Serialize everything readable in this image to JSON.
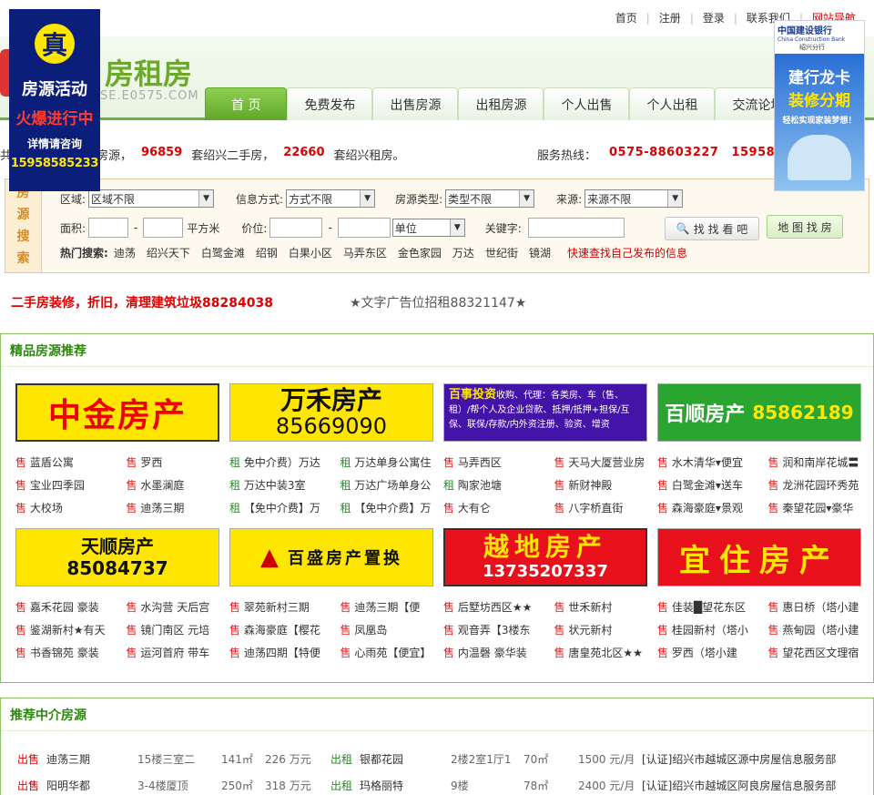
{
  "top_links": [
    "首页",
    "注册",
    "登录",
    "联系我们",
    "网站导航"
  ],
  "logo": {
    "title": "房租房",
    "sub": "SE.E0575.COM"
  },
  "nav": [
    "首 页",
    "免费发布",
    "出售房源",
    "出租房源",
    "个人出售",
    "个人出租",
    "交流论坛"
  ],
  "stats": {
    "prefix": "共",
    "mid1": "套房源，",
    "count1": "96859",
    "mid2": "套绍兴二手房，",
    "count2": "22660",
    "mid3": "套绍兴租房。",
    "hotline_label": "服务热线：",
    "hotline1": "0575-88603227",
    "hotline2": "159585"
  },
  "search": {
    "label": [
      "房",
      "源",
      "搜",
      "索"
    ],
    "area_label": "区域:",
    "area_value": "区域不限",
    "method_label": "信息方式:",
    "method_value": "方式不限",
    "type_label": "房源类型:",
    "type_value": "类型不限",
    "source_label": "来源:",
    "source_value": "来源不限",
    "size_label": "面积:",
    "size_unit": "平方米",
    "dash": "-",
    "price_label": "价位:",
    "price_unit": "单位",
    "keyword_label": "关键字:",
    "search_btn": "找 找 看 吧",
    "map_btn": "地 图 找 房",
    "hot_label": "热门搜索:",
    "hot_items": [
      "迪荡",
      "绍兴天下",
      "白鹭金滩",
      "绍钢",
      "白果小区",
      "马弄东区",
      "金色家园",
      "万达",
      "世纪街",
      "镜湖"
    ],
    "hot_red": "快速查找自己发布的信息"
  },
  "ads": {
    "left": "二手房装修，折旧，清理建筑垃圾88284038",
    "right": "★文字广告位招租88321147★"
  },
  "featured": {
    "title": "精品房源推荐",
    "banners1": [
      {
        "name": "中金房产",
        "phone": ""
      },
      {
        "name": "万禾房产",
        "phone": "85669090"
      },
      {
        "name": "百事投资",
        "phone": "收购、代理：各类房、车（售、租）/帮个人及企业贷款、抵押/抵押+担保/互保、联保/存款/内外资注册、验资、增资"
      },
      {
        "name": "百顺房产",
        "phone": "85862189"
      }
    ],
    "list1": [
      [
        [
          "售",
          "蓝盾公寓",
          "售",
          "罗西"
        ],
        [
          "售",
          "宝业四季园",
          "售",
          "水墨澜庭"
        ],
        [
          "售",
          "大校场",
          "售",
          "迪荡三期"
        ]
      ],
      [
        [
          "租",
          "免中介费）万达",
          "租",
          "万达单身公寓住"
        ],
        [
          "租",
          "万达中装3室",
          "租",
          "万达广场单身公"
        ],
        [
          "租",
          "【免中介费】万",
          "租",
          "【免中介费】万"
        ]
      ],
      [
        [
          "售",
          "马弄西区",
          "售",
          "天马大厦营业房"
        ],
        [
          "租",
          "陶家池塘",
          "售",
          "新财神殿"
        ],
        [
          "售",
          "大有仑",
          "售",
          "八字桥直街"
        ]
      ],
      [
        [
          "售",
          "水木清华▾便宜",
          "售",
          "润和南岸花城〓"
        ],
        [
          "售",
          "白鹭金滩▾送车",
          "售",
          "龙洲花园环秀苑"
        ],
        [
          "售",
          "森海豪庭▾景观",
          "售",
          "秦望花园▾豪华"
        ]
      ]
    ],
    "banners2": [
      {
        "name": "天顺房产",
        "phone": "85084737"
      },
      {
        "name": "百盛房产置换",
        "phone": ""
      },
      {
        "name": "越地房产",
        "phone": "13735207337"
      },
      {
        "name": "宜住房产",
        "phone": ""
      }
    ],
    "list2": [
      [
        [
          "售",
          "嘉禾花园 豪装",
          "售",
          "水沟营 天后宫"
        ],
        [
          "售",
          "鉴湖新村★有天",
          "售",
          "镜门南区 元培"
        ],
        [
          "售",
          "书香锦苑 豪装",
          "售",
          "运河首府 带车"
        ]
      ],
      [
        [
          "售",
          "翠苑新村三期",
          "售",
          "迪荡三期【便"
        ],
        [
          "售",
          "森海豪庭【樱花",
          "售",
          "凤凰岛"
        ],
        [
          "售",
          "迪荡四期【特便",
          "售",
          "心雨苑【便宜】"
        ]
      ],
      [
        [
          "售",
          "后墅坊西区★★",
          "售",
          "世禾新村"
        ],
        [
          "售",
          "观音弄【3楼东",
          "售",
          "状元新村"
        ],
        [
          "售",
          "内温磬 豪华装",
          "售",
          "唐皇苑北区★★"
        ]
      ],
      [
        [
          "售",
          "佳装█望花东区",
          "售",
          "惠日桥（塔小建"
        ],
        [
          "售",
          "桂园新村（塔小",
          "售",
          "燕甸园（塔小建"
        ],
        [
          "售",
          "罗西（塔小建",
          "售",
          "望花西区文理宿"
        ]
      ]
    ]
  },
  "agency": {
    "title": "推荐中介房源",
    "rows": [
      {
        "type1": "出售",
        "name1": "迪荡三期",
        "room1": "15楼三室二",
        "area1": "141㎡",
        "price1": "226 万元",
        "type2": "出租",
        "name2": "银都花园",
        "room2": "2楼2室1厅1",
        "area2": "70㎡",
        "price2": "1500 元/月",
        "agent": "[认证]绍兴市越城区源中房屋信息服务部"
      },
      {
        "type1": "出售",
        "name1": "阳明华都",
        "room1": "3-4楼厦顶",
        "area1": "250㎡",
        "price1": "318 万元",
        "type2": "出租",
        "name2": "玛格丽特",
        "room2": "9楼",
        "area2": "78㎡",
        "price2": "2400 元/月",
        "agent": "[认证]绍兴市越城区阿良房屋信息服务部"
      }
    ]
  },
  "float_left": {
    "badge": "真",
    "l1": "房源活动",
    "l2": "火爆进行中",
    "l3": "详情请咨询",
    "phone": "15958585233"
  },
  "float_right": {
    "bank": "中国建设银行",
    "bank_en": "China Construction Bank",
    "branch": "绍兴分行",
    "t1": "建行龙卡",
    "t2": "装修分期",
    "t3": "轻松实现家装梦想！"
  }
}
